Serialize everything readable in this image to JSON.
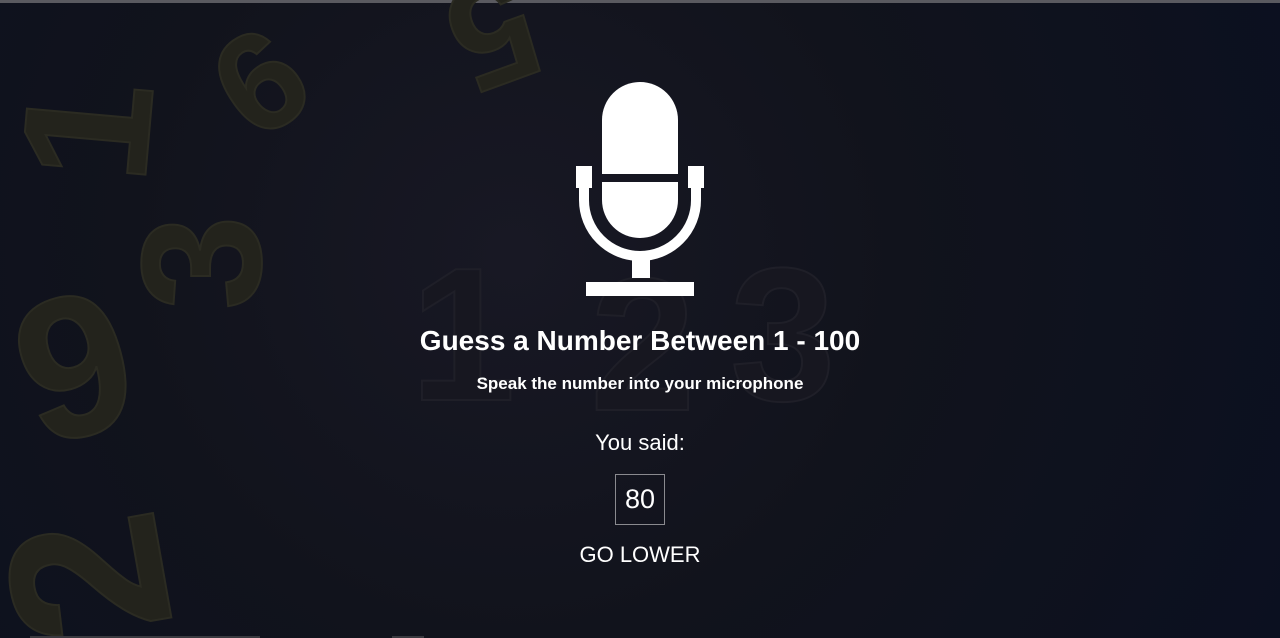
{
  "background": {
    "digit_color": "#2a2a1e",
    "digits": [
      "5",
      "6",
      "9",
      "1",
      "2",
      "3",
      "6",
      "9",
      "1",
      "2"
    ]
  },
  "icon": "microphone-icon",
  "title": "Guess a Number Between 1 - 100",
  "subtitle": "Speak the number into your microphone",
  "said_label": "You said:",
  "said_value": "80",
  "hint": "GO LOWER"
}
